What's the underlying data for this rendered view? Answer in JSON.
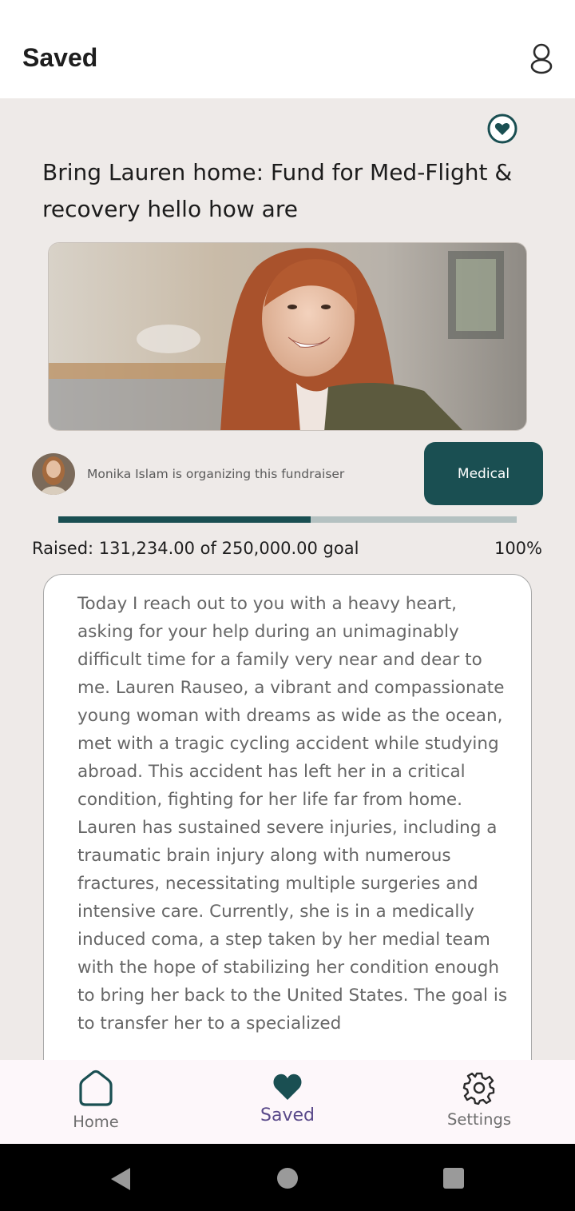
{
  "appbar": {
    "title": "Saved",
    "profile_icon": "person-outline-icon"
  },
  "fundraiser": {
    "saved_icon": "heart-circle-icon",
    "title": "Bring Lauren home: Fund for Med-Flight & recovery hello how are",
    "image_desc": "photo",
    "organizer_text": "Monika Islam is organizing this fundraiser",
    "category": "Medical",
    "progress_fraction": 0.55,
    "raised_text": "Raised: 131,234.00 of 250,000.00 goal",
    "percent_text": "100%",
    "story": "Today I reach out to you with a heavy heart, asking for your help during an unimaginably difficult time for a family very near and dear to me. Lauren Rauseo, a vibrant and compassionate young woman with dreams as wide as the ocean, met with a tragic cycling accident while studying abroad. This accident has left her in a critical condition, fighting for her life far from home.\nLauren has sustained severe injuries, including a traumatic brain injury along with numerous fractures, necessitating multiple surgeries and intensive care. Currently, she is in a medically induced coma, a step taken by her medial team with the hope of stabilizing her condition enough to bring her back to the United States. The goal is to transfer her to a specialized"
  },
  "nav": {
    "items": [
      {
        "label": "Home",
        "icon": "home-icon"
      },
      {
        "label": "Saved",
        "icon": "heart-icon"
      },
      {
        "label": "Settings",
        "icon": "gear-icon"
      }
    ]
  },
  "colors": {
    "accent": "#1a4f52",
    "progress_track": "#b4c1c1",
    "background": "#eeeae8",
    "nav_active": "#5a4a8a"
  }
}
